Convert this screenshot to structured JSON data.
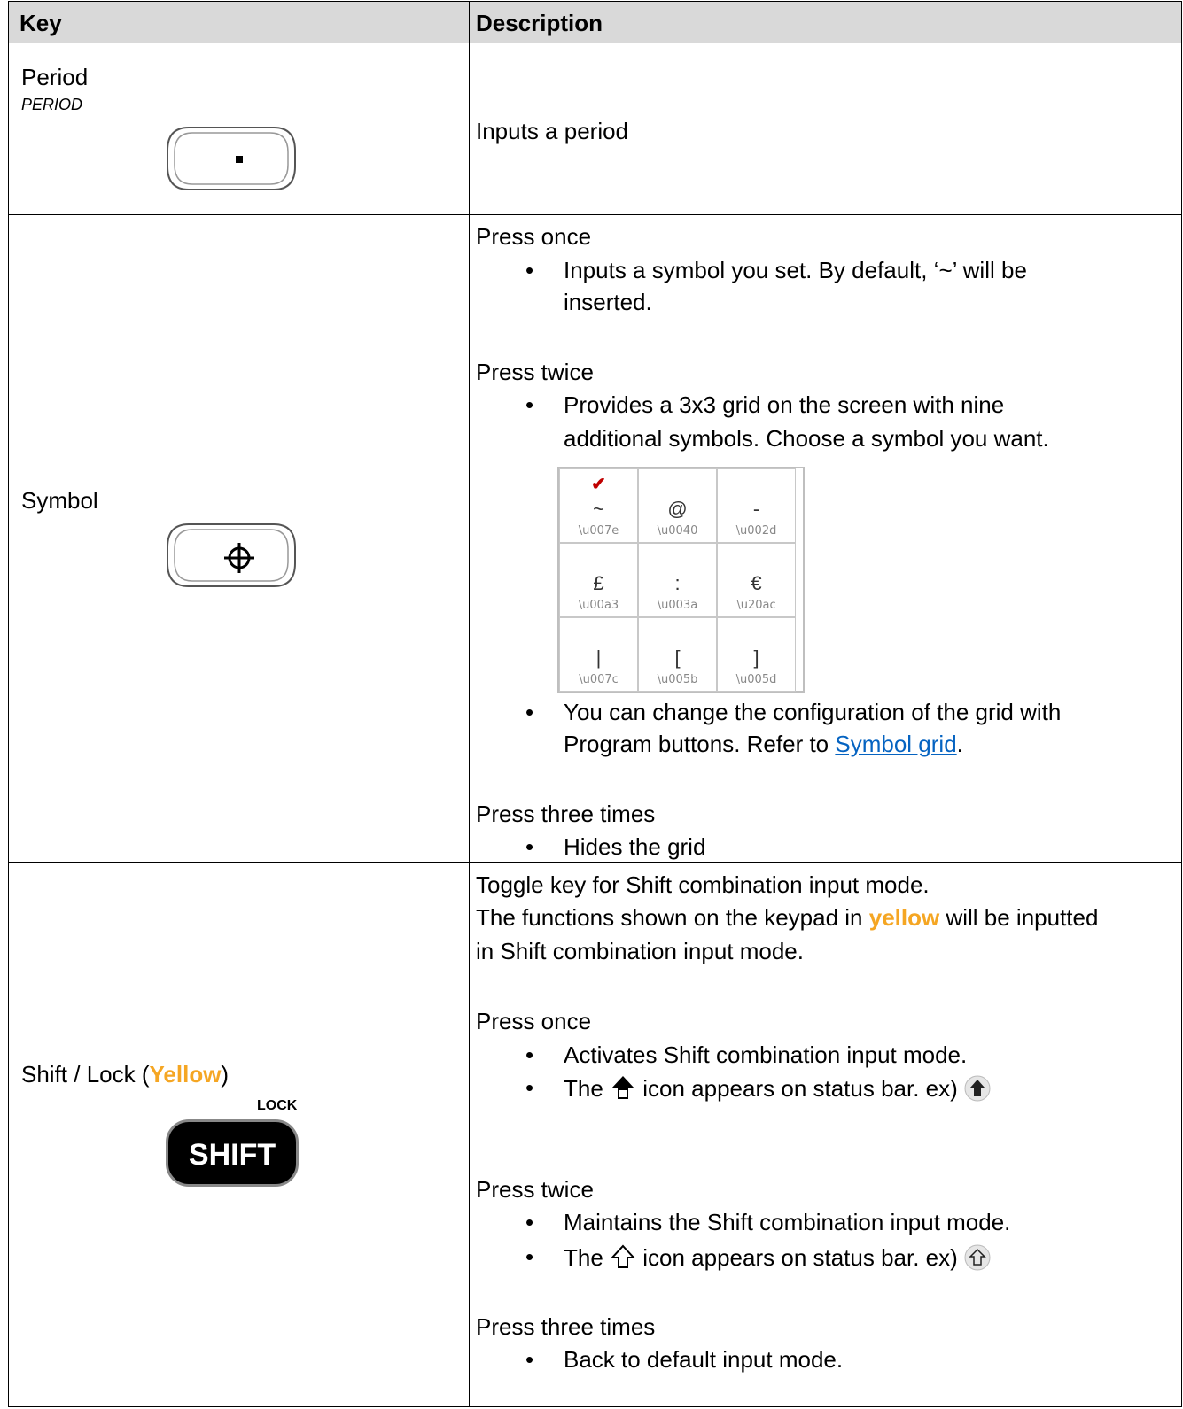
{
  "table": {
    "header": {
      "key": "Key",
      "description": "Description"
    },
    "rows": [
      {
        "key_name": "Period",
        "key_sub": "PERIOD",
        "description": "Inputs a period"
      },
      {
        "key_name": "Symbol",
        "press_once": "Press once",
        "once_b1_l1": "Inputs a symbol you set. By default, ‘~’ will be",
        "once_b1_l2": "inserted.",
        "press_twice": "Press twice",
        "twice_b1_l1": "Provides a 3x3 grid on the screen with nine",
        "twice_b1_l2": "additional symbols. Choose a symbol you want.",
        "twice_b2_l1": "You can change the configuration of the grid with",
        "twice_b2_l2_pre": "Program buttons. Refer to ",
        "twice_b2_link": "Symbol grid",
        "twice_b2_l2_post": ".",
        "press_three": "Press three times",
        "three_b1": "Hides the grid",
        "grid": [
          {
            "symbol": "~",
            "code": "\\u007e"
          },
          {
            "symbol": "@",
            "code": "\\u0040"
          },
          {
            "symbol": "-",
            "code": "\\u002d"
          },
          {
            "symbol": "£",
            "code": "\\u00a3"
          },
          {
            "symbol": ":",
            "code": "\\u003a"
          },
          {
            "symbol": "€",
            "code": "\\u20ac"
          },
          {
            "symbol": "|",
            "code": "\\u007c"
          },
          {
            "symbol": "[",
            "code": "\\u005b"
          },
          {
            "symbol": "]",
            "code": "\\u005d"
          }
        ],
        "grid_selected_mark": "✔"
      },
      {
        "key_name_pre": "Shift / Lock (",
        "key_name_yellow": "Yellow",
        "key_name_post": ")",
        "lock_label": "LOCK",
        "shift_label": "SHIFT",
        "intro_l1": "Toggle key for Shift combination input mode.",
        "intro_l2_pre": "The functions shown on the keypad in ",
        "intro_l2_yellow": "yellow",
        "intro_l2_post": " will be inputted",
        "intro_l3": "in Shift combination input mode.",
        "press_once": "Press once",
        "once_b1": "Activates Shift combination input mode.",
        "once_b2_pre": "The ",
        "once_b2_post": " icon appears on status bar. ex) ",
        "press_twice": "Press twice",
        "twice_b1": "Maintains the Shift combination input mode.",
        "twice_b2_pre": "The ",
        "twice_b2_post": " icon appears on status bar. ex) ",
        "press_three": "Press three times",
        "three_b1": "Back to default input mode."
      }
    ]
  },
  "bullet_char": "•",
  "colors": {
    "header_bg": "#d9d9d9",
    "yellow": "#f5a623",
    "link": "#0563c1",
    "check": "#c00000"
  }
}
